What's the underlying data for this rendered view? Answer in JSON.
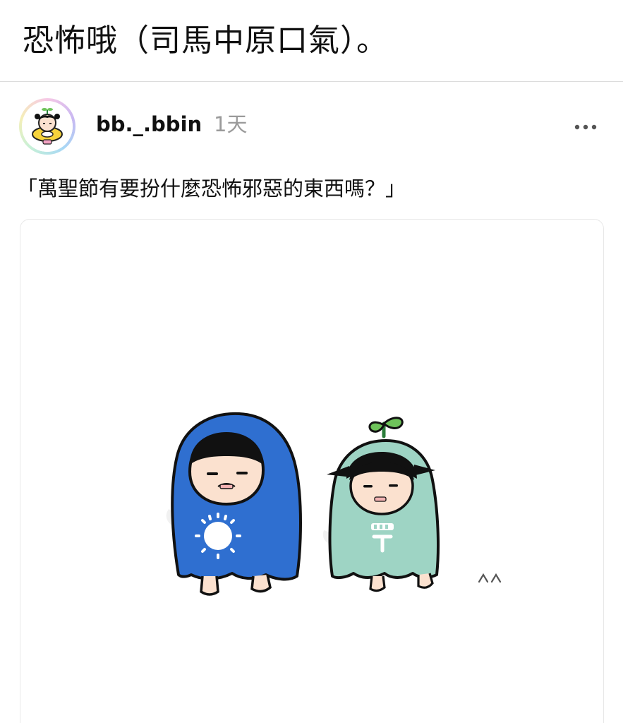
{
  "caption": "恐怖哦（司馬中原口氣）。",
  "post": {
    "username": "bb._.bbin",
    "timestamp": "1天",
    "text": "「萬聖節有要扮什麼恐怖邪惡的東西嗎？」",
    "avatar_icon": "cartoon-character-avatar",
    "more_icon": "more-options-icon"
  },
  "illustration": {
    "description_icon": "two-cartoon-characters-in-blue-and-green-costumes",
    "colors": {
      "blue_costume": "#2f6fd0",
      "green_costume": "#9ed4c4",
      "sprout": "#6ec35a",
      "skin": "#fbe1cf"
    }
  }
}
